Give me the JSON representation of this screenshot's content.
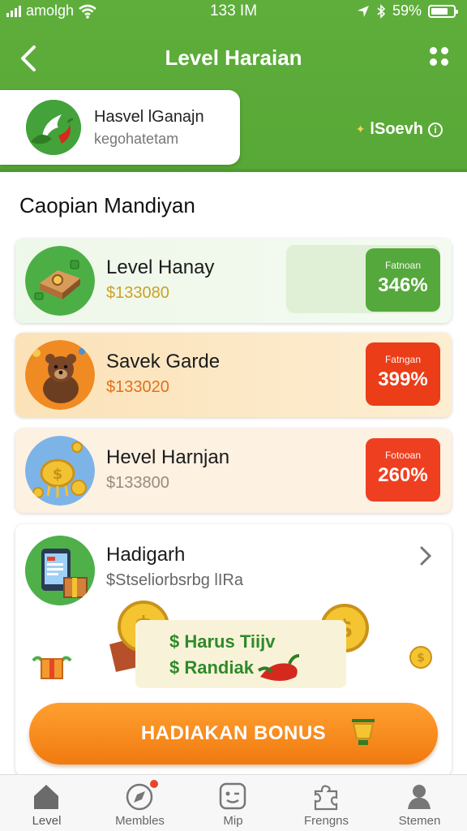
{
  "status_bar": {
    "carrier": "amolgh",
    "time": "133 IM",
    "battery": "59%",
    "icons": [
      "signal-icon",
      "wifi-icon",
      "location-icon",
      "bluetooth-icon",
      "battery-icon"
    ]
  },
  "nav": {
    "title": "Level Haraian",
    "back_icon": "chevron-left-icon",
    "menu_icon": "grid-dots-icon"
  },
  "profile": {
    "name": "Hasvel lGanajn",
    "subtitle": "kegohatetam"
  },
  "header_badge": {
    "label": "lSoevh",
    "icon": "info-icon"
  },
  "section": {
    "title": "Caopian Mandiyan"
  },
  "levels": [
    {
      "name": "Level Hanay",
      "amount": "$133080",
      "pct_label": "Fatnoan",
      "pct_value": "346%",
      "accent": "#55a83c"
    },
    {
      "name": "Savek Garde",
      "amount": "$133020",
      "pct_label": "Fatngan",
      "pct_value": "399%",
      "accent": "#ea3d18"
    },
    {
      "name": "Hevel Harnjan",
      "amount": "$133800",
      "pct_label": "Fotooan",
      "pct_value": "260%",
      "accent": "#ee4020"
    }
  ],
  "reward": {
    "name": "Hadigarh",
    "description": "$Stseliorbsrbg lIRa",
    "promo_line1": "$ Harus Tiijv",
    "promo_line2": "$ Randiak"
  },
  "bonus_button": {
    "label": "HADIAKAN BONUS"
  },
  "tabs": [
    {
      "label": "Level",
      "icon": "home-icon",
      "active": true
    },
    {
      "label": "Membles",
      "icon": "compass-icon",
      "active": false
    },
    {
      "label": "Mip",
      "icon": "face-icon",
      "active": false
    },
    {
      "label": "Frengns",
      "icon": "puzzle-icon",
      "active": false
    },
    {
      "label": "Stemen",
      "icon": "user-icon",
      "active": false
    }
  ],
  "colors": {
    "brand_green": "#5fae3c",
    "orange": "#f58a1e",
    "red": "#ea3d18"
  }
}
